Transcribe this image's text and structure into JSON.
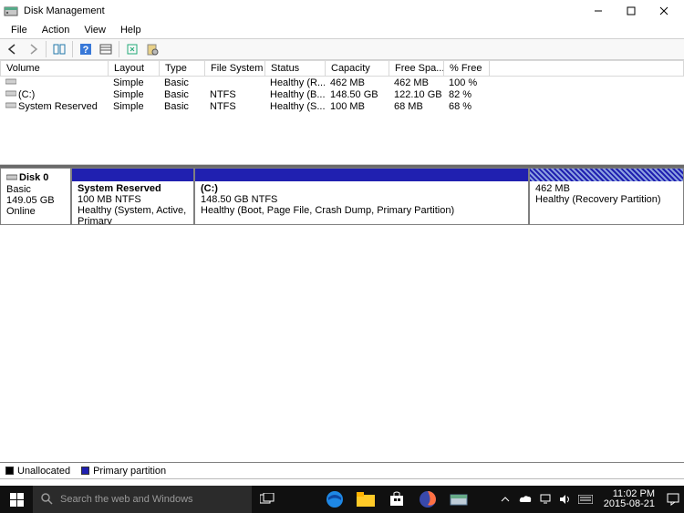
{
  "window": {
    "title": "Disk Management"
  },
  "menu": {
    "file": "File",
    "action": "Action",
    "view": "View",
    "help": "Help"
  },
  "columns": {
    "volume": "Volume",
    "layout": "Layout",
    "type": "Type",
    "fs": "File System",
    "status": "Status",
    "capacity": "Capacity",
    "freespace": "Free Spa...",
    "pctfree": "% Free"
  },
  "volumes": [
    {
      "name": "",
      "layout": "Simple",
      "type": "Basic",
      "fs": "",
      "status": "Healthy (R...",
      "capacity": "462 MB",
      "free": "462 MB",
      "pct": "100 %"
    },
    {
      "name": "(C:)",
      "layout": "Simple",
      "type": "Basic",
      "fs": "NTFS",
      "status": "Healthy (B...",
      "capacity": "148.50 GB",
      "free": "122.10 GB",
      "pct": "82 %"
    },
    {
      "name": "System Reserved",
      "layout": "Simple",
      "type": "Basic",
      "fs": "NTFS",
      "status": "Healthy (S...",
      "capacity": "100 MB",
      "free": "68 MB",
      "pct": "68 %"
    }
  ],
  "disk": {
    "label": "Disk 0",
    "type": "Basic",
    "size": "149.05 GB",
    "state": "Online",
    "partitions": [
      {
        "name": "System Reserved",
        "sub": "100 MB NTFS",
        "detail": "Healthy (System, Active, Primary",
        "kind": "primary"
      },
      {
        "name": "(C:)",
        "sub": "148.50 GB NTFS",
        "detail": "Healthy (Boot, Page File, Crash Dump, Primary Partition)",
        "kind": "primary"
      },
      {
        "name": "",
        "sub": "462 MB",
        "detail": "Healthy (Recovery Partition)",
        "kind": "recovery"
      }
    ]
  },
  "legend": {
    "unalloc": "Unallocated",
    "primary": "Primary partition"
  },
  "taskbar": {
    "search_placeholder": "Search the web and Windows",
    "time": "11:02 PM",
    "date": "2015-08-21"
  },
  "colors": {
    "primary_part": "#2020b0",
    "unalloc": "#000000"
  }
}
